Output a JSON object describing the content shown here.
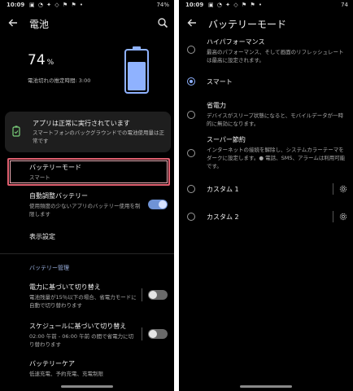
{
  "left": {
    "status": {
      "time": "10:09",
      "icons": "▣ ◔ ✦ ◇ ⚑ ⚑ •",
      "battery": "74%"
    },
    "title": "電池",
    "battery": {
      "percent": "74",
      "unit": "%",
      "level": 0.74,
      "estimate": "電池切れの推定時間: 3:00"
    },
    "status_card": {
      "title": "アプリは正常に実行されています",
      "desc": "スマートフォンのバックグラウンドでの電池使用量は正常です"
    },
    "battery_mode": {
      "title": "バッテリーモード",
      "value": "スマート"
    },
    "adaptive": {
      "title": "自動調整バッテリー",
      "desc": "使用頻度の少ないアプリのバッテリー使用を制限します",
      "on": true
    },
    "display_settings": "表示設定",
    "section": "バッテリー管理",
    "switch_power": {
      "title": "電力に基づいて切り替え",
      "desc": "電池残量が15％以下の場合、省電力モードに自動で切り替わります",
      "on": false
    },
    "switch_schedule": {
      "title": "スケジュールに基づいて切り替え",
      "desc": "02:00 午前 - 06:00 午前 の間で省電力に切り替わります",
      "on": false
    },
    "care": {
      "title": "バッテリーケア",
      "desc": "低速充電、予約充電、充電制限"
    }
  },
  "right": {
    "status": {
      "time": "10:09",
      "icons": "▣ ◔ ✦ ◇ ⚑ ⚑ •",
      "battery": "74"
    },
    "title": "バッテリーモード",
    "modes": [
      {
        "title": "ハイパフォーマンス",
        "desc": "最高のパフォーマンス、そして画面のリフレッシュレートは最高に設定されます。",
        "selected": false
      },
      {
        "title": "スマート",
        "desc": "",
        "selected": true
      },
      {
        "title": "省電力",
        "desc": "デバイスがスリープ状態になると、モバイルデータが一時的に無効になります。",
        "selected": false
      },
      {
        "title": "スーパー節約",
        "desc": "インターネットの接続を解除し、システムカラーテーマをダークに設定します。● 電話、SMS、アラームは利用可能です。",
        "selected": false
      },
      {
        "title": "カスタム 1",
        "desc": "",
        "selected": false
      },
      {
        "title": "カスタム 2",
        "desc": "",
        "selected": false
      }
    ]
  },
  "colors": {
    "accent": "#8fb2ff",
    "toggle_on": "#6f93d6",
    "highlight": "#e06070",
    "section": "#9fb6e6"
  }
}
